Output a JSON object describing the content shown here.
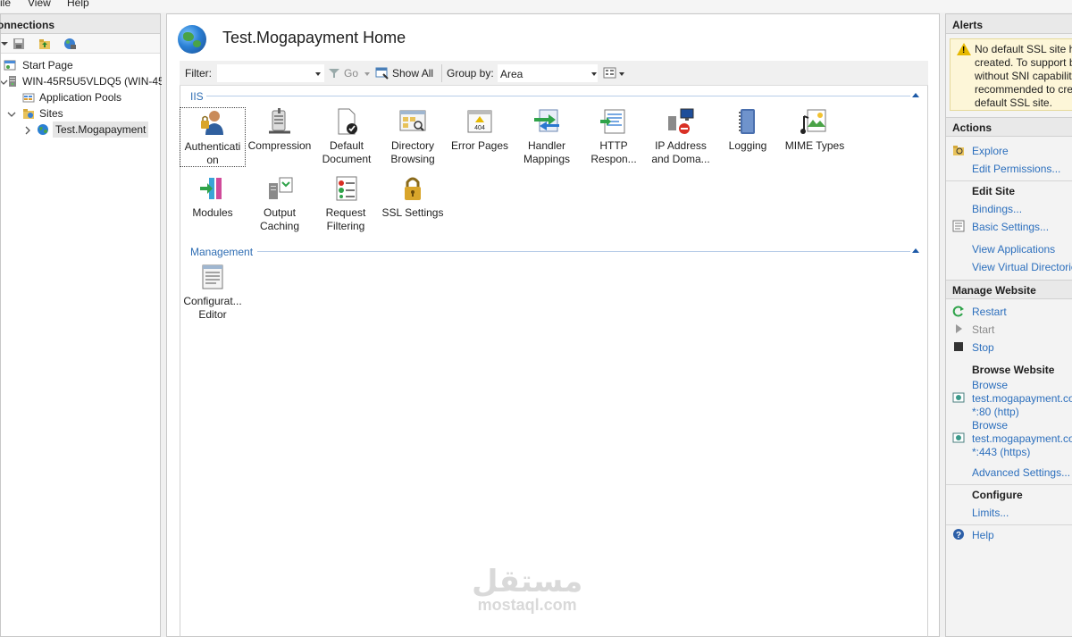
{
  "menu": {
    "file": "ile",
    "view": "View",
    "help": "Help"
  },
  "connections": {
    "title": "onnections",
    "tree": [
      {
        "label": "Start Page"
      },
      {
        "label": "WIN-45R5U5VLDQ5 (WIN-45R"
      },
      {
        "label": "Application Pools"
      },
      {
        "label": "Sites"
      },
      {
        "label": "Test.Mogapayment"
      }
    ]
  },
  "center": {
    "title": "Test.Mogapayment Home",
    "filter": {
      "label": "Filter:",
      "go": "Go",
      "show_all": "Show All",
      "group_by_label": "Group by:",
      "group_by_value": "Area"
    },
    "groups": [
      {
        "name": "IIS",
        "items": [
          {
            "label": "Authentication",
            "line1": "Authenticati",
            "line2": "on",
            "icon": "authentication-icon"
          },
          {
            "label": "Compression",
            "line1": "Compression",
            "line2": "",
            "icon": "compression-icon"
          },
          {
            "label": "Default Document",
            "line1": "Default",
            "line2": "Document",
            "icon": "default-document-icon"
          },
          {
            "label": "Directory Browsing",
            "line1": "Directory",
            "line2": "Browsing",
            "icon": "directory-browsing-icon"
          },
          {
            "label": "Error Pages",
            "line1": "Error Pages",
            "line2": "",
            "icon": "error-pages-icon"
          },
          {
            "label": "Handler Mappings",
            "line1": "Handler",
            "line2": "Mappings",
            "icon": "handler-mappings-icon"
          },
          {
            "label": "HTTP Respon...",
            "line1": "HTTP",
            "line2": "Respon...",
            "icon": "http-response-icon"
          },
          {
            "label": "IP Address and Doma...",
            "line1": "IP Address",
            "line2": "and Doma...",
            "icon": "ip-address-icon"
          },
          {
            "label": "Logging",
            "line1": "Logging",
            "line2": "",
            "icon": "logging-icon"
          },
          {
            "label": "MIME Types",
            "line1": "MIME Types",
            "line2": "",
            "icon": "mime-types-icon"
          },
          {
            "label": "Modules",
            "line1": "Modules",
            "line2": "",
            "icon": "modules-icon"
          },
          {
            "label": "Output Caching",
            "line1": "Output",
            "line2": "Caching",
            "icon": "output-caching-icon"
          },
          {
            "label": "Request Filtering",
            "line1": "Request",
            "line2": "Filtering",
            "icon": "request-filtering-icon"
          },
          {
            "label": "SSL Settings",
            "line1": "SSL Settings",
            "line2": "",
            "icon": "ssl-settings-icon"
          }
        ]
      },
      {
        "name": "Management",
        "items": [
          {
            "label": "Configuration Editor",
            "line1": "Configurat...",
            "line2": "Editor",
            "icon": "configuration-editor-icon"
          }
        ]
      }
    ]
  },
  "alerts": {
    "title": "Alerts",
    "lines": [
      "No default SSL site ha",
      "created. To support b",
      "without SNI capabilit",
      "recommended to cre",
      "default SSL site."
    ]
  },
  "actions": {
    "title": "Actions",
    "explore": "Explore",
    "edit_permissions": "Edit Permissions...",
    "edit_site_title": "Edit Site",
    "bindings": "Bindings...",
    "basic_settings": "Basic Settings...",
    "view_applications": "View Applications",
    "view_virtual_directories": "View Virtual Directorie",
    "manage_website_title": "Manage Website",
    "restart": "Restart",
    "start": "Start",
    "stop": "Stop",
    "browse_website_title": "Browse Website",
    "browse_http": [
      "Browse",
      "test.mogapayment.co",
      "*:80 (http)"
    ],
    "browse_https": [
      "Browse",
      "test.mogapayment.co",
      "*:443 (https)"
    ],
    "advanced_settings": "Advanced Settings...",
    "configure_title": "Configure",
    "limits": "Limits...",
    "help": "Help"
  },
  "watermark": {
    "arabic": "مستقل",
    "latin": "mostaql.com"
  }
}
